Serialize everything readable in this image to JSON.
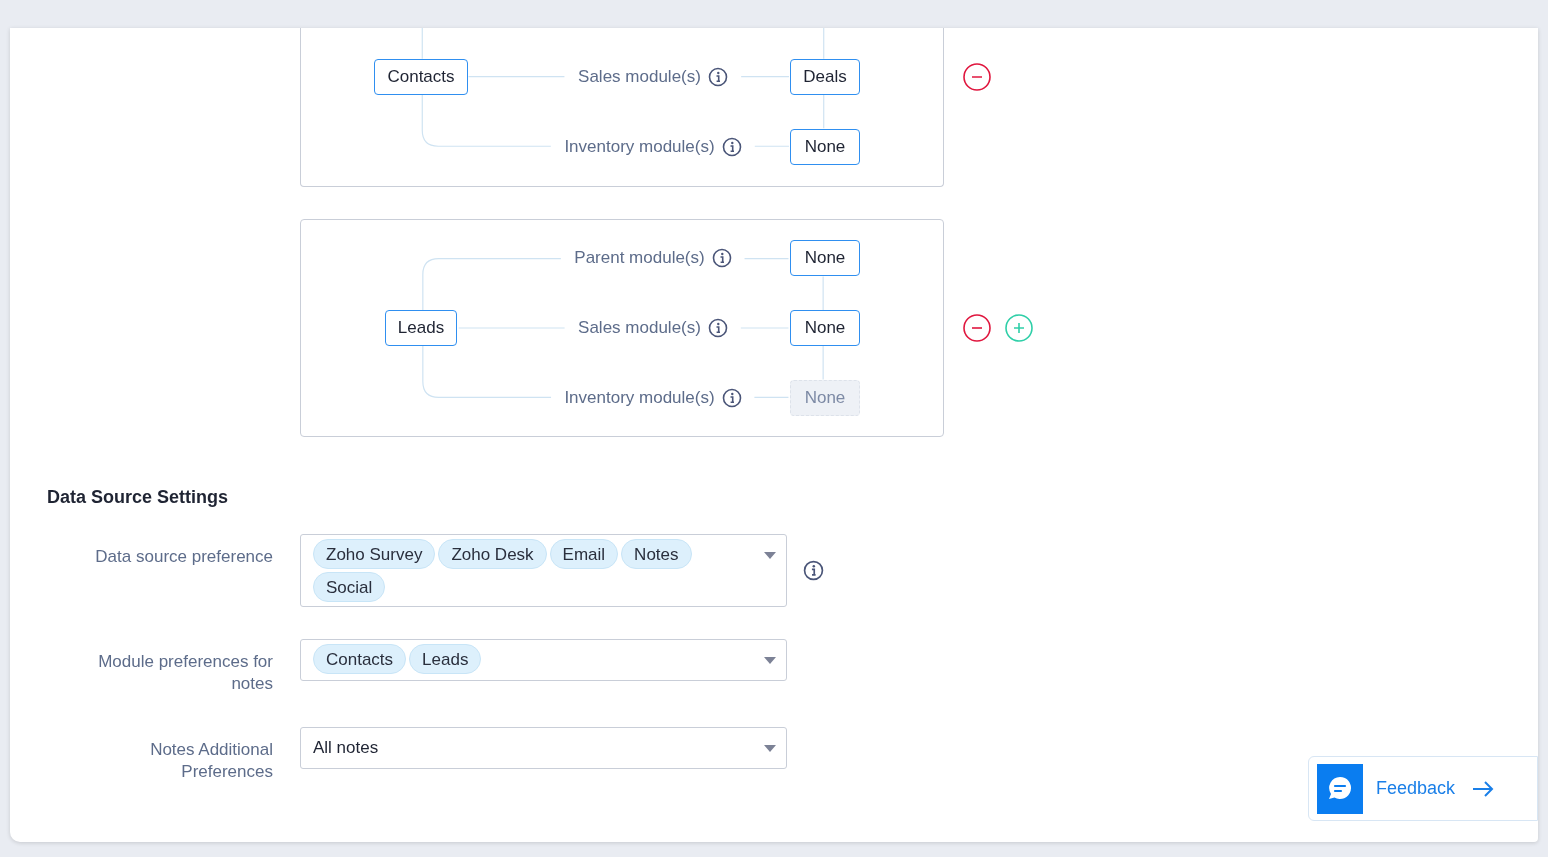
{
  "mappings": [
    {
      "cut_top": true,
      "rows": [
        {
          "source": "Contacts",
          "label": "Sales module(s)",
          "target": "Deals",
          "disabled": false
        },
        {
          "label": "Inventory module(s)",
          "target": "None",
          "disabled": false
        }
      ],
      "actions": [
        {
          "kind": "remove"
        }
      ]
    },
    {
      "cut_top": false,
      "rows": [
        {
          "label": "Parent module(s)",
          "target": "None",
          "disabled": false
        },
        {
          "source": "Leads",
          "label": "Sales module(s)",
          "target": "None",
          "disabled": false
        },
        {
          "label": "Inventory module(s)",
          "target": "None",
          "disabled": true
        }
      ],
      "actions": [
        {
          "kind": "remove"
        },
        {
          "kind": "add"
        }
      ]
    }
  ],
  "data_source_settings": {
    "title": "Data Source Settings",
    "fields": [
      {
        "label": "Data source preference",
        "kind": "multi",
        "chips": [
          "Zoho Survey",
          "Zoho Desk",
          "Email",
          "Notes",
          "Social"
        ],
        "info": true
      },
      {
        "label": "Module preferences for notes",
        "kind": "multi",
        "chips": [
          "Contacts",
          "Leads"
        ],
        "info": false
      },
      {
        "label": "Notes Additional Preferences",
        "kind": "single",
        "value": "All notes",
        "info": false
      }
    ]
  },
  "feedback": {
    "label": "Feedback"
  }
}
